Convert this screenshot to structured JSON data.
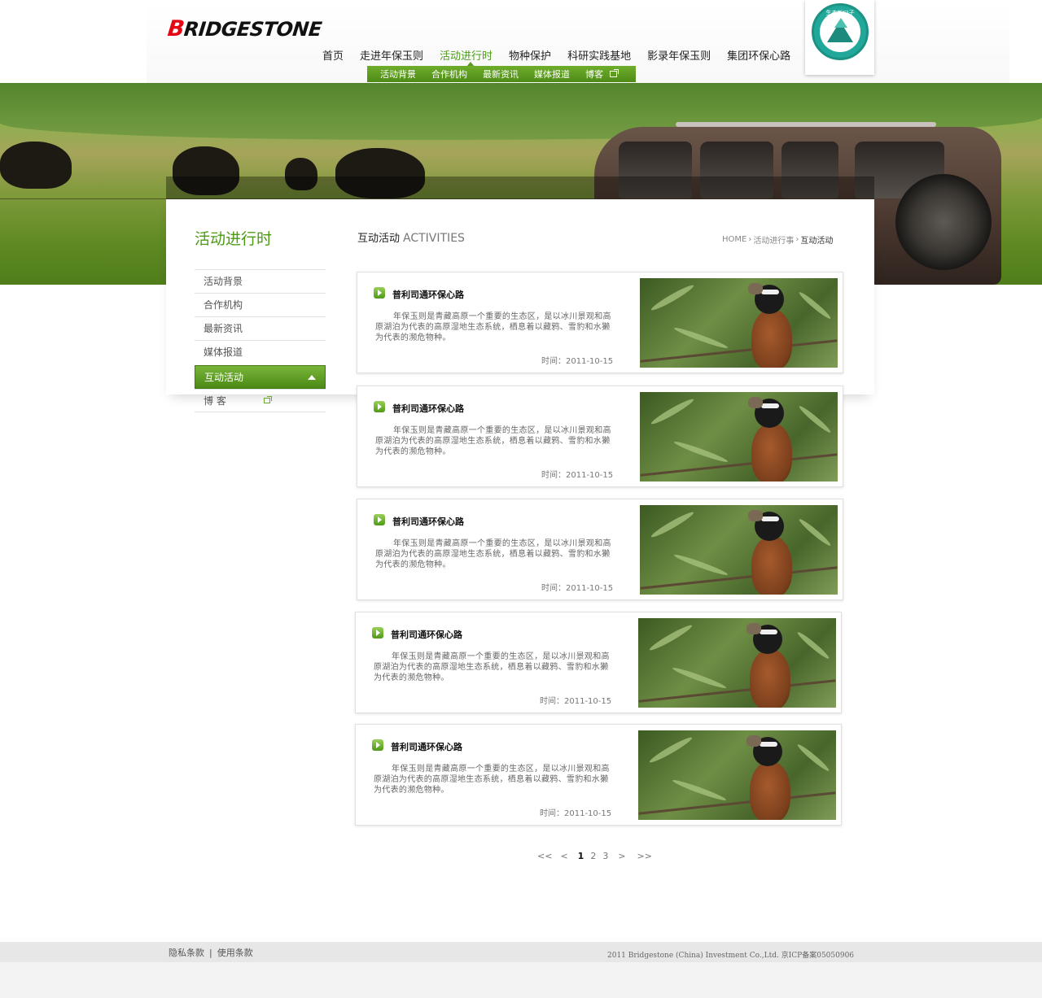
{
  "brand": {
    "logo_text": "BRIDGESTONE",
    "badge_text": "生态新口子"
  },
  "nav": {
    "items": [
      "首页",
      "走进年保玉则",
      "活动进行时",
      "物种保护",
      "科研实践基地",
      "影录年保玉则",
      "集团环保心路"
    ],
    "active_index": 2
  },
  "subnav": {
    "items": [
      "活动背景",
      "合作机构",
      "最新资讯",
      "媒体报道",
      "博客"
    ]
  },
  "sidebar": {
    "title": "活动进行时",
    "items": [
      "活动背景",
      "合作机构",
      "最新资讯",
      "媒体报道",
      "互动活动",
      "博 客"
    ],
    "active_index": 4
  },
  "main": {
    "heading_cn": "互动活动",
    "heading_en": "ACTIVITIES",
    "breadcrumb": [
      "HOME",
      "活动进行事",
      "互动活动"
    ]
  },
  "articles": [
    {
      "title": "普利司通环保心路",
      "text": "年保玉则是青藏高原一个重要的生态区，是以冰川景观和高原湖泊为代表的高原湿地生态系统，栖息着以藏鸦、雪豹和水獭为代表的濒危物种。",
      "date": "时间：2011-10-15"
    },
    {
      "title": "普利司通环保心路",
      "text": "年保玉则是青藏高原一个重要的生态区，是以冰川景观和高原湖泊为代表的高原湿地生态系统，栖息着以藏鸦、雪豹和水獭为代表的濒危物种。",
      "date": "时间：2011-10-15"
    },
    {
      "title": "普利司通环保心路",
      "text": "年保玉则是青藏高原一个重要的生态区，是以冰川景观和高原湖泊为代表的高原湿地生态系统，栖息着以藏鸦、雪豹和水獭为代表的濒危物种。",
      "date": "时间：2011-10-15"
    },
    {
      "title": "普利司通环保心路",
      "text": "年保玉则是青藏高原一个重要的生态区，是以冰川景观和高原湖泊为代表的高原湿地生态系统，栖息着以藏鸦、雪豹和水獭为代表的濒危物种。",
      "date": "时间：2011-10-15"
    },
    {
      "title": "普利司通环保心路",
      "text": "年保玉则是青藏高原一个重要的生态区，是以冰川景观和高原湖泊为代表的高原湿地生态系统，栖息着以藏鸦、雪豹和水獭为代表的濒危物种。",
      "date": "时间：2011-10-15"
    }
  ],
  "pagination": {
    "first": "<<",
    "prev": "<",
    "pages": [
      "1",
      "2",
      "3"
    ],
    "current": "1",
    "next": ">",
    "last": ">>"
  },
  "footer": {
    "privacy": "隐私条款",
    "sep": "|",
    "terms": "使用条款",
    "copyright": "2011 Bridgestone (China) Investment Co.,Ltd. 京ICP备案05050906"
  },
  "colors": {
    "accent_green": "#4b9a12",
    "nav_bar": "#5a9a22"
  },
  "icons": [
    "external-link-icon",
    "arrow-up-icon",
    "bullet-arrow-icon"
  ]
}
